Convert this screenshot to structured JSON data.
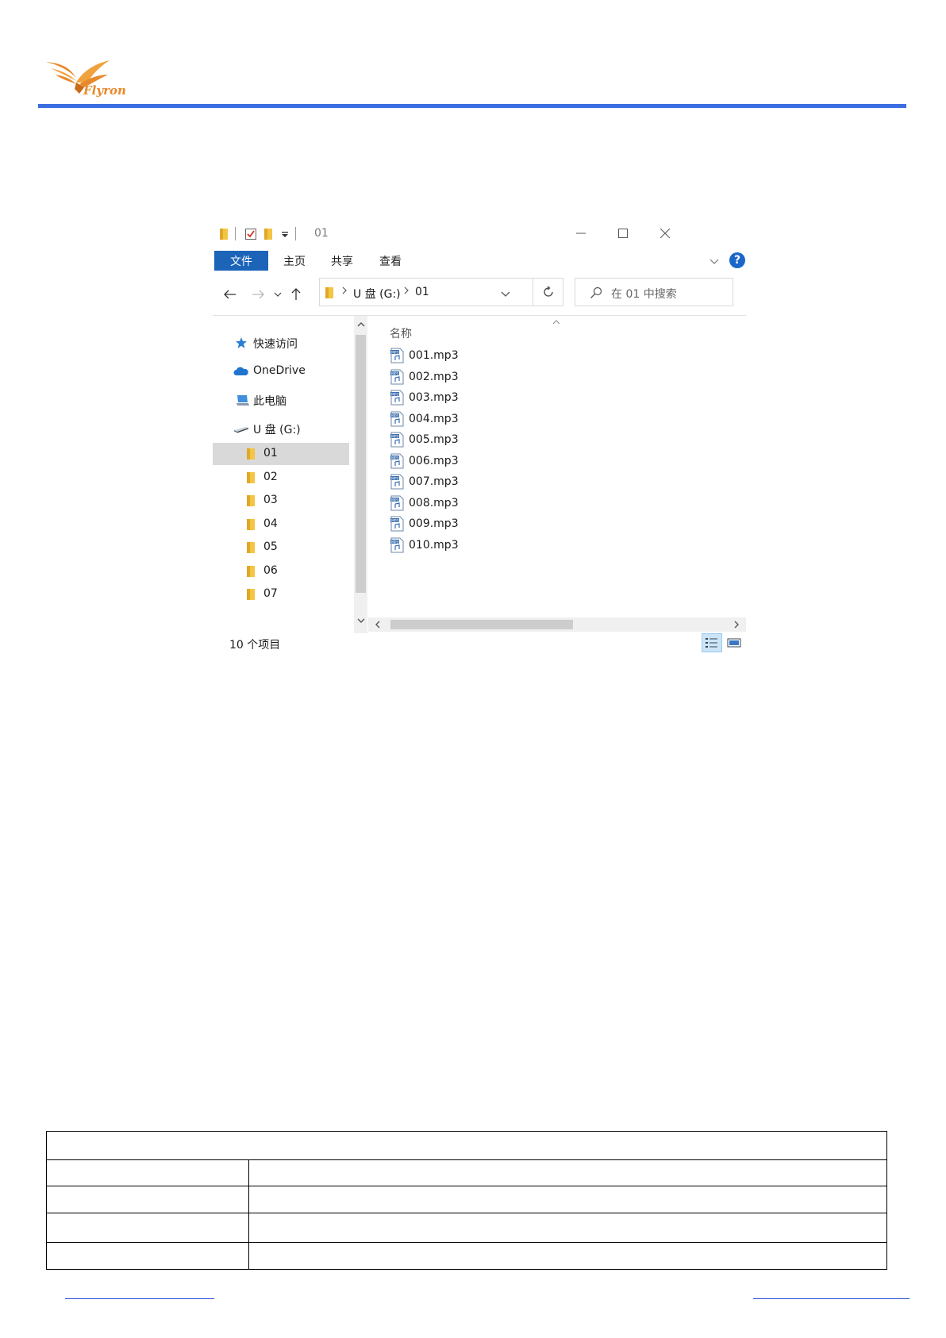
{
  "logo": {
    "text": "Flyron",
    "icon": "phoenix-bird-icon",
    "color": "#e8892b"
  },
  "header": {
    "rule_color": "#3b6ee0"
  },
  "explorer": {
    "title": "01",
    "ribbon": {
      "file_tab": "文件",
      "tabs": [
        "主页",
        "共享",
        "查看"
      ],
      "help": "?"
    },
    "address": {
      "segments": [
        "U 盘 (G:)",
        "01"
      ]
    },
    "search_placeholder": "在 01 中搜索",
    "nav_pane": {
      "items": [
        {
          "label": "快速访问",
          "icon": "star-icon"
        },
        {
          "label": "OneDrive",
          "icon": "cloud-icon"
        },
        {
          "label": "此电脑",
          "icon": "computer-icon"
        },
        {
          "label": "U 盘 (G:)",
          "icon": "usb-drive-icon"
        }
      ],
      "folders": [
        "01",
        "02",
        "03",
        "04",
        "05",
        "06",
        "07"
      ],
      "selected_folder": "01"
    },
    "column_header": "名称",
    "files": [
      "001.mp3",
      "002.mp3",
      "003.mp3",
      "004.mp3",
      "005.mp3",
      "006.mp3",
      "007.mp3",
      "008.mp3",
      "009.mp3",
      "010.mp3"
    ],
    "status": "10 个项目",
    "colors": {
      "accent": "#1c64b8",
      "folder": "#f4c542",
      "selection": "#d9d9d9"
    }
  },
  "footer": {
    "rule_color": "#2d4fd4"
  }
}
